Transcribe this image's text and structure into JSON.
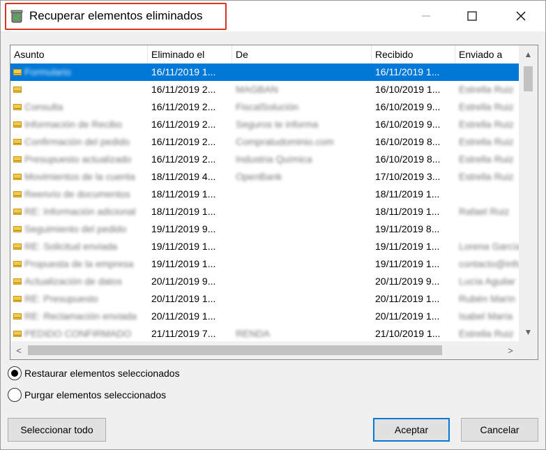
{
  "window": {
    "title": "Recuperar elementos eliminados"
  },
  "titlebar_buttons": {
    "minimize_glyph": "—",
    "maximize_glyph": "☐",
    "close_glyph": "✕"
  },
  "table": {
    "columns": [
      "Asunto",
      "Eliminado el",
      "De",
      "Recibido",
      "Enviado a"
    ],
    "rows": [
      {
        "asunto": "Formulario",
        "eliminado": "16/11/2019 1...",
        "de": "",
        "recibido": "16/11/2019 1...",
        "enviado": "",
        "selected": true
      },
      {
        "asunto": "",
        "eliminado": "16/11/2019 2...",
        "de": "MAGBAN",
        "recibido": "16/10/2019 1...",
        "enviado": "Estrella Ruiz"
      },
      {
        "asunto": "Consulta",
        "eliminado": "16/11/2019 2...",
        "de": "FiscalSolución",
        "recibido": "16/10/2019 9...",
        "enviado": "Estrella Ruiz"
      },
      {
        "asunto": "Información de Recibo",
        "eliminado": "16/11/2019 2...",
        "de": "Seguros te informa",
        "recibido": "16/10/2019 9...",
        "enviado": "Estrella Ruiz"
      },
      {
        "asunto": "Confirmación del pedido",
        "eliminado": "16/11/2019 2...",
        "de": "Compratudominio.com",
        "recibido": "16/10/2019 8...",
        "enviado": "Estrella Ruiz"
      },
      {
        "asunto": "Presupuesto actualizado",
        "eliminado": "16/11/2019 2...",
        "de": "Industria Química",
        "recibido": "16/10/2019 8...",
        "enviado": "Estrella Ruiz"
      },
      {
        "asunto": "Movimientos de la cuenta",
        "eliminado": "18/11/2019 4...",
        "de": "OpenBank",
        "recibido": "17/10/2019 3...",
        "enviado": "Estrella Ruiz"
      },
      {
        "asunto": "Reenvío de documentos",
        "eliminado": "18/11/2019 1...",
        "de": "",
        "recibido": "18/11/2019 1...",
        "enviado": ""
      },
      {
        "asunto": "RE: Información adicional",
        "eliminado": "18/11/2019 1...",
        "de": "",
        "recibido": "18/11/2019 1...",
        "enviado": "Rafael Ruiz"
      },
      {
        "asunto": "Seguimiento del pedido",
        "eliminado": "19/11/2019 9...",
        "de": "",
        "recibido": "19/11/2019 8...",
        "enviado": ""
      },
      {
        "asunto": "RE: Solicitud enviada",
        "eliminado": "19/11/2019 1...",
        "de": "",
        "recibido": "19/11/2019 1...",
        "enviado": "Lorena García"
      },
      {
        "asunto": "Propuesta de la empresa",
        "eliminado": "19/11/2019 1...",
        "de": "",
        "recibido": "19/11/2019 1...",
        "enviado": "contacto@info"
      },
      {
        "asunto": "Actualización de datos",
        "eliminado": "20/11/2019 9...",
        "de": "",
        "recibido": "20/11/2019 9...",
        "enviado": "Lucía Aguilar"
      },
      {
        "asunto": "RE: Presupuesto",
        "eliminado": "20/11/2019 1...",
        "de": "",
        "recibido": "20/11/2019 1...",
        "enviado": "Rubén Marín"
      },
      {
        "asunto": "RE: Reclamación enviada",
        "eliminado": "20/11/2019 1...",
        "de": "",
        "recibido": "20/11/2019 1...",
        "enviado": "Isabel María"
      },
      {
        "asunto": "PEDIDO CONFIRMADO",
        "eliminado": "21/11/2019 7...",
        "de": "RENDA",
        "recibido": "21/10/2019 1...",
        "enviado": "Estrella Ruiz"
      }
    ]
  },
  "options": {
    "restore_label": "Restaurar elementos seleccionados",
    "purge_label": "Purgar elementos seleccionados",
    "selected": "restore"
  },
  "buttons": {
    "select_all": "Seleccionar todo",
    "accept": "Aceptar",
    "cancel": "Cancelar"
  },
  "colors": {
    "selection": "#0078d7",
    "highlight_box": "#d9331f"
  }
}
